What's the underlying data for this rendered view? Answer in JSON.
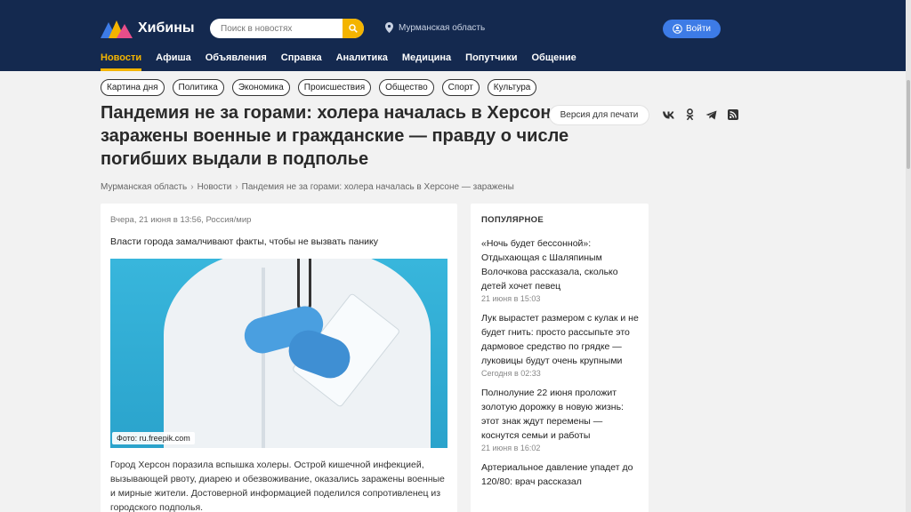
{
  "header": {
    "logo_text": "Хибины",
    "search_placeholder": "Поиск в новостях",
    "region": "Мурманская область",
    "login_label": "Войти",
    "nav": [
      "Новости",
      "Афиша",
      "Объявления",
      "Справка",
      "Аналитика",
      "Медицина",
      "Попутчики",
      "Общение"
    ],
    "active_nav": "Новости",
    "colors": {
      "header_bg": "#14294f",
      "accent": "#f4b400",
      "login_bg": "#3d7be6"
    }
  },
  "tags": [
    "Картина дня",
    "Политика",
    "Экономика",
    "Происшествия",
    "Общество",
    "Спорт",
    "Культура"
  ],
  "article": {
    "title": "Пандемия не за горами: холера началась в Херсоне — заражены военные и гражданские — правду о числе погибших выдали в подполье",
    "print_label": "Версия для печати",
    "share_icons": [
      "vk-icon",
      "ok-icon",
      "telegram-icon",
      "rss-icon"
    ],
    "breadcrumb": [
      "Мурманская область",
      "Новости",
      "Пандемия не за горами: холера началась в Херсоне — заражены"
    ],
    "meta": "Вчера, 21 июня в 13:56, Россия/мир",
    "lead": "Власти города замалчивают факты, чтобы не вызвать панику",
    "photo_caption": "Фото: ru.freepik.com",
    "body": "Город Херсон поразила вспышка холеры. Острой кишечной инфекцией, вызывающей рвоту, диарею и обезвоживание, оказались заражены военные и мирные жители. Достоверной информацией поделился сопротивленец из городского подполья."
  },
  "sidebar": {
    "title": "ПОПУЛЯРНОЕ",
    "items": [
      {
        "title": "«Ночь будет бессонной»: Отдыхающая с Шаляпиным Волочкова рассказала, сколько детей хочет певец",
        "time": "21 июня в 15:03"
      },
      {
        "title": "Лук вырастет размером с кулак и не будет гнить: просто рассыпьте это дармовое средство по грядке — луковицы будут очень крупными",
        "time": "Сегодня в 02:33"
      },
      {
        "title": "Полнолуние 22 июня проложит золотую дорожку в новую жизнь: этот знак ждут перемены — коснутся семьи и работы",
        "time": "21 июня в 16:02"
      },
      {
        "title": "Артериальное давление упадет до 120/80: врач рассказал",
        "time": ""
      }
    ]
  }
}
